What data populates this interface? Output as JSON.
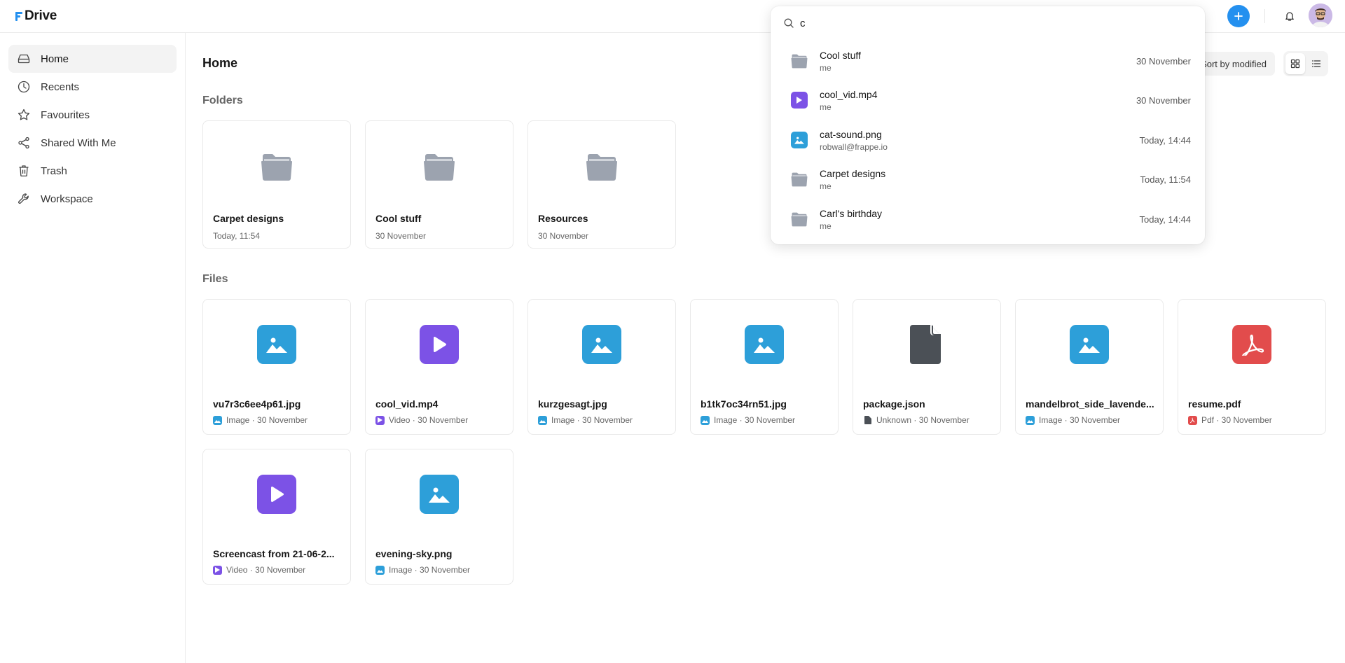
{
  "app": {
    "name": "Drive"
  },
  "colors": {
    "accent": "#2490ef",
    "image": "#2d9fd9",
    "video": "#7c52e6",
    "pdf": "#e24c4c",
    "unknown": "#4b5056",
    "folder": "#9ca3af"
  },
  "search": {
    "query": "c",
    "results": [
      {
        "name": "Cool stuff",
        "owner": "me",
        "date": "30 November",
        "icon": "folder-icon"
      },
      {
        "name": "cool_vid.mp4",
        "owner": "me",
        "date": "30 November",
        "icon": "video-icon"
      },
      {
        "name": "cat-sound.png",
        "owner": "robwall@frappe.io",
        "date": "Today, 14:44",
        "icon": "image-icon"
      },
      {
        "name": "Carpet designs",
        "owner": "me",
        "date": "Today, 11:54",
        "icon": "folder-icon"
      },
      {
        "name": "Carl's birthday",
        "owner": "me",
        "date": "Today, 14:44",
        "icon": "folder-icon"
      }
    ]
  },
  "sidebar": {
    "items": [
      {
        "label": "Home",
        "icon": "hard-drive-icon"
      },
      {
        "label": "Recents",
        "icon": "clock-icon"
      },
      {
        "label": "Favourites",
        "icon": "star-icon"
      },
      {
        "label": "Shared With Me",
        "icon": "share-icon"
      },
      {
        "label": "Trash",
        "icon": "trash-icon"
      },
      {
        "label": "Workspace",
        "icon": "wrench-icon"
      }
    ]
  },
  "main": {
    "title": "Home",
    "sort_label": "Sort by modified",
    "folders_title": "Folders",
    "files_title": "Files",
    "folders": [
      {
        "name": "Carpet designs",
        "date": "Today, 11:54"
      },
      {
        "name": "Cool stuff",
        "date": "30 November"
      },
      {
        "name": "Resources",
        "date": "30 November"
      }
    ],
    "files": [
      {
        "name": "vu7r3c6ee4p61.jpg",
        "meta": "Image · 30 November",
        "kind": "image"
      },
      {
        "name": "cool_vid.mp4",
        "meta": "Video · 30 November",
        "kind": "video"
      },
      {
        "name": "kurzgesagt.jpg",
        "meta": "Image · 30 November",
        "kind": "image"
      },
      {
        "name": "b1tk7oc34rn51.jpg",
        "meta": "Image · 30 November",
        "kind": "image"
      },
      {
        "name": "package.json",
        "meta": "Unknown · 30 November",
        "kind": "unknown"
      },
      {
        "name": "mandelbrot_side_lavende...",
        "meta": "Image · 30 November",
        "kind": "image"
      },
      {
        "name": "resume.pdf",
        "meta": "Pdf · 30 November",
        "kind": "pdf"
      },
      {
        "name": "Screencast from 21-06-2...",
        "meta": "Video · 30 November",
        "kind": "video"
      },
      {
        "name": "evening-sky.png",
        "meta": "Image · 30 November",
        "kind": "image"
      }
    ]
  }
}
